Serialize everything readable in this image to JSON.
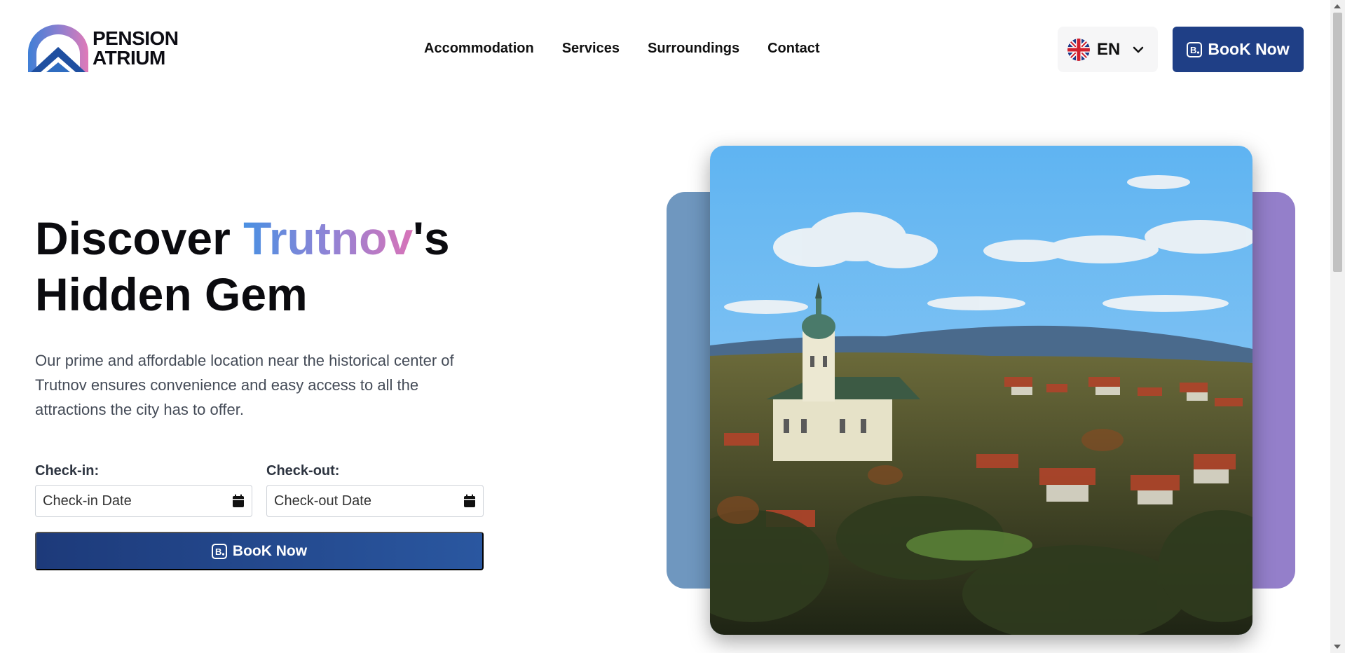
{
  "header": {
    "logo_line1": "PENSION",
    "logo_line2": "ATRIUM",
    "nav": [
      {
        "label": "Accommodation"
      },
      {
        "label": "Services"
      },
      {
        "label": "Surroundings"
      },
      {
        "label": "Contact"
      }
    ],
    "language": {
      "code": "EN",
      "flag_icon": "uk-flag-icon"
    },
    "book_button": "BooK Now"
  },
  "hero": {
    "title_part1": "Discover ",
    "title_highlight": "Trutnov",
    "title_part2": "'s",
    "title_line2": "Hidden Gem",
    "description": "Our prime and affordable location near the historical center of Trutnov ensures convenience and easy access to all the attractions the city has to offer.",
    "checkin": {
      "label": "Check-in:",
      "placeholder": "Check-in Date",
      "icon": "calendar-icon"
    },
    "checkout": {
      "label": "Check-out:",
      "placeholder": "Check-out Date",
      "icon": "calendar-icon"
    },
    "book_button": "BooK Now",
    "booking_icon": "booking-com-icon"
  },
  "colors": {
    "primary": "#1f3f86",
    "gradient_start": "#4a90e2",
    "gradient_end": "#d873b8",
    "accent_blue": "#6f97bf",
    "accent_purple": "#947fca"
  }
}
